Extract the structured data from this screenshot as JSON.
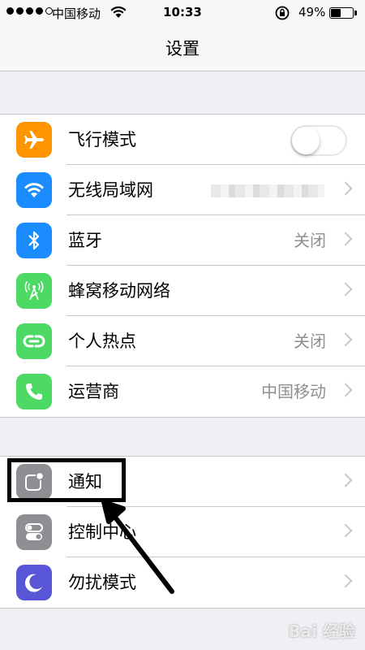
{
  "status_bar": {
    "carrier": "中国移动",
    "time": "10:33",
    "battery_percent": "49%",
    "battery_level": 0.49,
    "signal_bars_filled": 4,
    "signal_bars_total": 5
  },
  "nav": {
    "title": "设置"
  },
  "groups": [
    {
      "rows": [
        {
          "label": "飞行模式",
          "icon": "airplane-icon",
          "color": "#ff9500",
          "control": "toggle",
          "toggle_on": false
        },
        {
          "label": "无线局域网",
          "icon": "wifi-icon",
          "color": "#1a8cff",
          "value_obscured": true
        },
        {
          "label": "蓝牙",
          "icon": "bluetooth-icon",
          "color": "#1a8cff",
          "value": "关闭"
        },
        {
          "label": "蜂窝移动网络",
          "icon": "cellular-icon",
          "color": "#4cd964"
        },
        {
          "label": "个人热点",
          "icon": "hotspot-icon",
          "color": "#4cd964",
          "value": "关闭"
        },
        {
          "label": "运营商",
          "icon": "phone-icon",
          "color": "#4cd964",
          "value": "中国移动"
        }
      ]
    },
    {
      "rows": [
        {
          "label": "通知",
          "icon": "notifications-icon",
          "color": "#8e8e93"
        },
        {
          "label": "控制中心",
          "icon": "control-center-icon",
          "color": "#8e8e93"
        },
        {
          "label": "勿扰模式",
          "icon": "moon-icon",
          "color": "#5856d6"
        }
      ]
    }
  ],
  "annotation": {
    "highlighted_row": "通知"
  },
  "watermark": "Bai 经验"
}
